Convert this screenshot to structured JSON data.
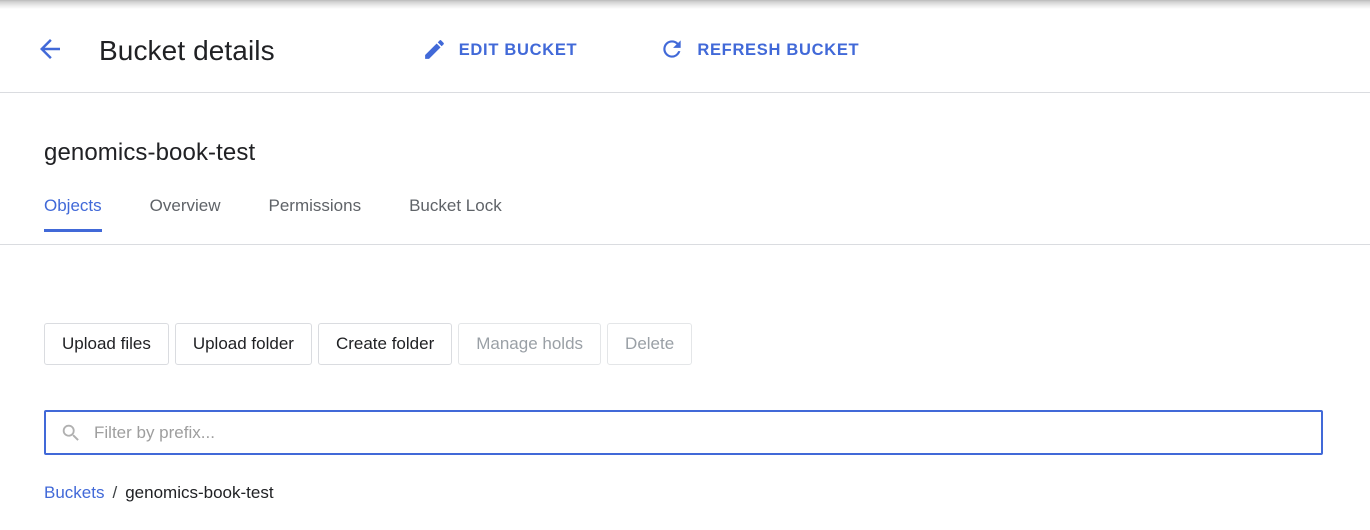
{
  "header": {
    "back_icon": "arrow-left-icon",
    "title": "Bucket details",
    "actions": [
      {
        "icon": "pencil-icon",
        "label": "EDIT BUCKET"
      },
      {
        "icon": "refresh-icon",
        "label": "REFRESH BUCKET"
      }
    ]
  },
  "bucket": {
    "name": "genomics-book-test"
  },
  "tabs": [
    {
      "label": "Objects",
      "active": true
    },
    {
      "label": "Overview",
      "active": false
    },
    {
      "label": "Permissions",
      "active": false
    },
    {
      "label": "Bucket Lock",
      "active": false
    }
  ],
  "toolbar": {
    "buttons": [
      {
        "label": "Upload files",
        "disabled": false
      },
      {
        "label": "Upload folder",
        "disabled": false
      },
      {
        "label": "Create folder",
        "disabled": false
      },
      {
        "label": "Manage holds",
        "disabled": true
      },
      {
        "label": "Delete",
        "disabled": true
      }
    ]
  },
  "filter": {
    "icon": "search-icon",
    "value": "",
    "placeholder": "Filter by prefix..."
  },
  "breadcrumb": {
    "root_label": "Buckets",
    "separator": "/",
    "current_label": "genomics-book-test"
  },
  "colors": {
    "accent_blue": "#4169d8",
    "text_primary": "#202124",
    "text_secondary": "#5f6368",
    "text_disabled": "#9aa0a6",
    "border": "#dadce0"
  }
}
